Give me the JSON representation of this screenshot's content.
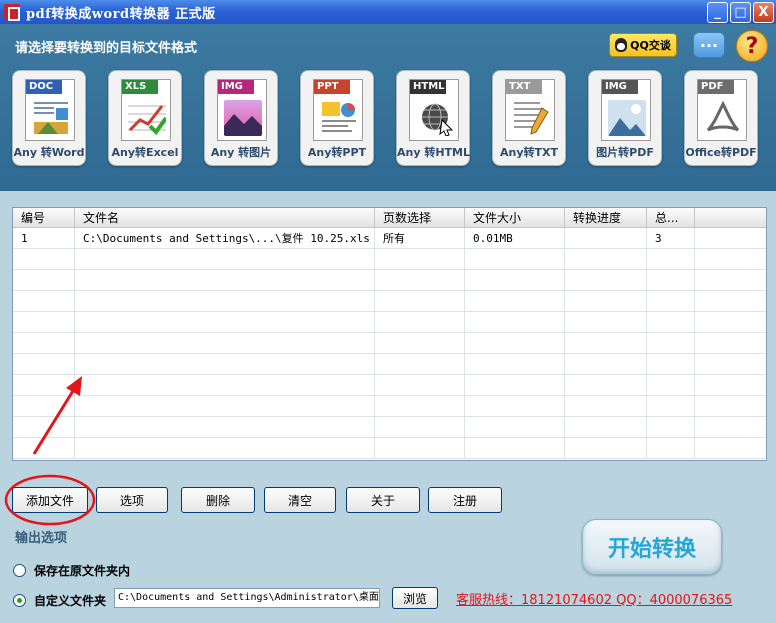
{
  "window": {
    "title": "pdf转换成word转换器 正式版",
    "controls": [
      "_",
      "□",
      "X"
    ]
  },
  "top": {
    "heading": "请选择要转换到的目标文件格式",
    "qq_label": "QQ交谈",
    "chat_label": "···",
    "help_label": "?"
  },
  "formats": [
    {
      "band": "DOC",
      "label": "Any 转Word",
      "band_color": "#2f62b5",
      "icon": "word-doc-icon"
    },
    {
      "band": "XLS",
      "label": "Any转Excel",
      "band_color": "#2e8b3a",
      "icon": "excel-chart-icon"
    },
    {
      "band": "IMG",
      "label": "Any 转图片",
      "band_color": "#b3287a",
      "icon": "image-icon"
    },
    {
      "band": "PPT",
      "label": "Any转PPT",
      "band_color": "#c8432b",
      "icon": "ppt-icon"
    },
    {
      "band": "HTML",
      "label": "Any 转HTML",
      "band_color": "#333333",
      "icon": "html-globe-icon"
    },
    {
      "band": "TXT",
      "label": "Any转TXT",
      "band_color": "#9a9a9a",
      "icon": "txt-icon"
    },
    {
      "band": "IMG",
      "label": "图片转PDF",
      "band_color": "#555555",
      "icon": "image-to-pdf-icon"
    },
    {
      "band": "PDF",
      "label": "Office转PDF",
      "band_color": "#6d6d6d",
      "icon": "pdf-icon"
    }
  ],
  "table": {
    "headers": [
      "编号",
      "文件名",
      "页数选择",
      "文件大小",
      "转换进度",
      "总...",
      ""
    ],
    "rows": [
      [
        "1",
        "C:\\Documents and Settings\\...\\复件 10.25.xls",
        "所有",
        "0.01MB",
        "",
        "3",
        ""
      ]
    ]
  },
  "buttons": {
    "add": "添加文件",
    "options": "选项",
    "delete": "删除",
    "clear": "清空",
    "about": "关于",
    "register": "注册",
    "browse": "浏览",
    "start": "开始转换"
  },
  "output": {
    "label": "输出选项",
    "keep_original": "保存在原文件夹内",
    "custom_folder": "自定义文件夹",
    "path": "C:\\Documents and Settings\\Administrator\\桌面"
  },
  "hotline": "客服热线：18121074602 QQ：4000076365",
  "colors": {
    "accent_red": "#e3151a",
    "start_text": "#23a7d6",
    "top_panel": "#3d7aa1"
  }
}
